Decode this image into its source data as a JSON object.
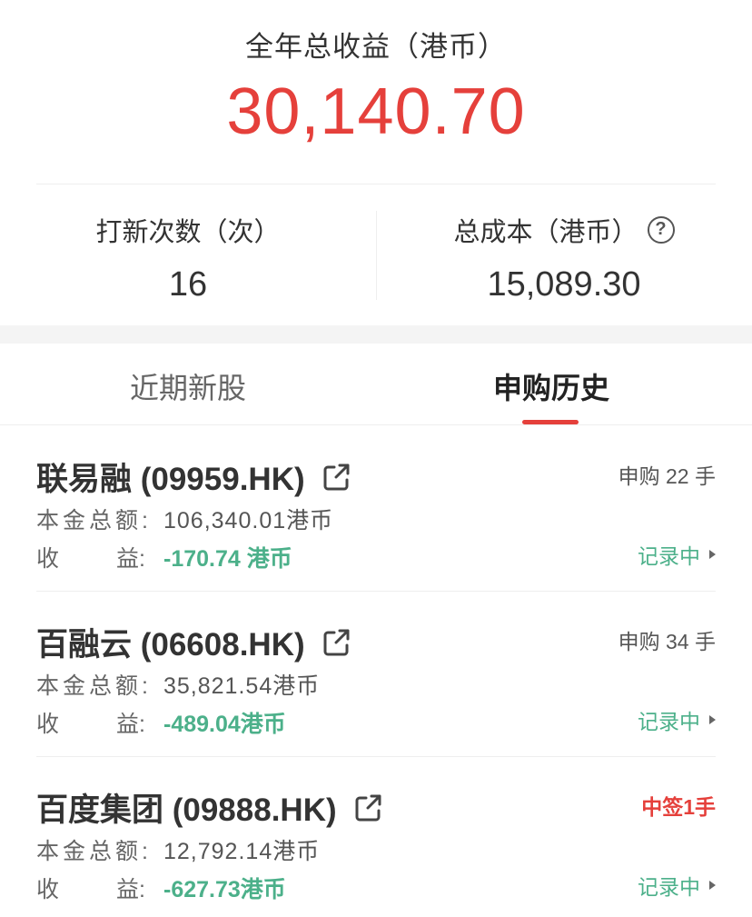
{
  "summary": {
    "annual_label": "全年总收益（港币）",
    "annual_value": "30,140.70",
    "ipo_count_label": "打新次数（次）",
    "ipo_count_value": "16",
    "total_cost_label": "总成本（港币）",
    "total_cost_value": "15,089.30",
    "help_icon_glyph": "?"
  },
  "tabs": [
    {
      "label": "近期新股",
      "active": false
    },
    {
      "label": "申购历史",
      "active": true
    }
  ],
  "colors": {
    "accent_red": "#e5403b",
    "loss_green": "#4cb08a"
  },
  "history": [
    {
      "name": "联易融 (09959.HK)",
      "tag": "申购 22 手",
      "principal_label": "本金总额:",
      "principal_value": "106,340.01港币",
      "profit_label_a": "收",
      "profit_label_b": "益:",
      "profit_value": "-170.74 港币",
      "status": "记录中"
    },
    {
      "name": "百融云 (06608.HK)",
      "tag": "申购 34 手",
      "principal_label": "本金总额:",
      "principal_value": "35,821.54港币",
      "profit_label_a": "收",
      "profit_label_b": "益:",
      "profit_value": "-489.04港币",
      "status": "记录中"
    },
    {
      "name": "百度集团 (09888.HK)",
      "tag": "中签1手",
      "principal_label": "本金总额:",
      "principal_value": "12,792.14港币",
      "profit_label_a": "收",
      "profit_label_b": "益:",
      "profit_value": "-627.73港币",
      "status": "记录中"
    }
  ]
}
